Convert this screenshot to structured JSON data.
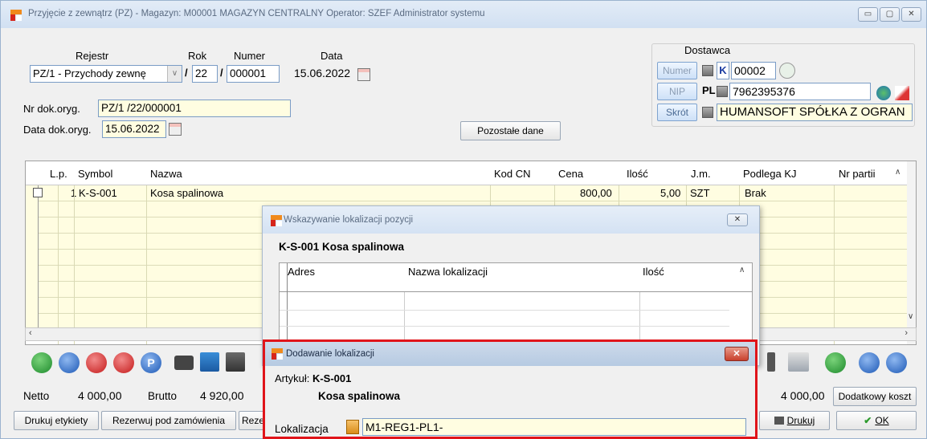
{
  "window": {
    "title": "Przyjęcie z zewnątrz (PZ) - Magazyn: M00001 MAGAZYN CENTRALNY  Operator: SZEF Administrator systemu"
  },
  "header": {
    "rejestr_label": "Rejestr",
    "rok_label": "Rok",
    "numer_label": "Numer",
    "data_label": "Data",
    "rejestr_value": "PZ/1  - Przychody zewnę",
    "rok_value": "22",
    "numer_value": "000001",
    "data_value": "15.06.2022",
    "sep1": "/",
    "sep2": "/",
    "nr_dok_label": "Nr dok.oryg.",
    "nr_dok_value": "PZ/1  /22/000001",
    "data_dok_label": "Data dok.oryg.",
    "data_dok_value": "15.06.2022",
    "pozostale_btn": "Pozostałe dane"
  },
  "dostawca": {
    "title": "Dostawca",
    "numer_btn": "Numer",
    "k_label": "K",
    "numer_value": "00002",
    "nip_btn": "NIP",
    "pl_label": "PL",
    "nip_value": "7962395376",
    "skrot_btn": "Skrót",
    "skrot_value": "HUMANSOFT SPÓŁKA Z OGRAN"
  },
  "grid": {
    "columns": [
      "L.p.",
      "Symbol",
      "Nazwa",
      "Kod CN",
      "Cena",
      "Ilość",
      "J.m.",
      "Podlega KJ",
      "Nr partii"
    ],
    "rows": [
      {
        "lp": "1",
        "symbol": "K-S-001",
        "nazwa": "Kosa spalinowa",
        "kodcn": "",
        "cena": "800,00",
        "ilosc": "5,00",
        "jm": "SZT",
        "kj": "Brak",
        "partia": ""
      }
    ]
  },
  "totals": {
    "netto_label": "Netto",
    "netto_value": "4 000,00",
    "brutto_label": "Brutto",
    "brutto_value": "4 920,00",
    "right_value": "4 000,00",
    "dodatkowy_btn": "Dodatkowy koszt"
  },
  "buttons": {
    "drukuj_etykiety": "Drukuj etykiety",
    "rezerwuj": "Rezerwuj pod zamówienia",
    "rez_partial": "Reze",
    "drukuj": "Drukuj",
    "ok": "OK"
  },
  "dialog_lokalizacja": {
    "title": "Wskazywanie lokalizacji pozycji",
    "heading": "K-S-001 Kosa spalinowa",
    "columns": [
      "Adres",
      "Nazwa lokalizacji",
      "Ilość"
    ]
  },
  "dialog_dodawanie": {
    "title": "Dodawanie lokalizacji",
    "artykul_label": "Artykuł:",
    "artykul_code": "K-S-001",
    "artykul_name": "Kosa spalinowa",
    "lokalizacja_label": "Lokalizacja",
    "lokalizacja_value": "M1-REG1-PL1-"
  },
  "colors": {
    "field_bg": "#fffde1",
    "highlight_border": "#e0141a",
    "title_bar": "#d4e2f3"
  }
}
